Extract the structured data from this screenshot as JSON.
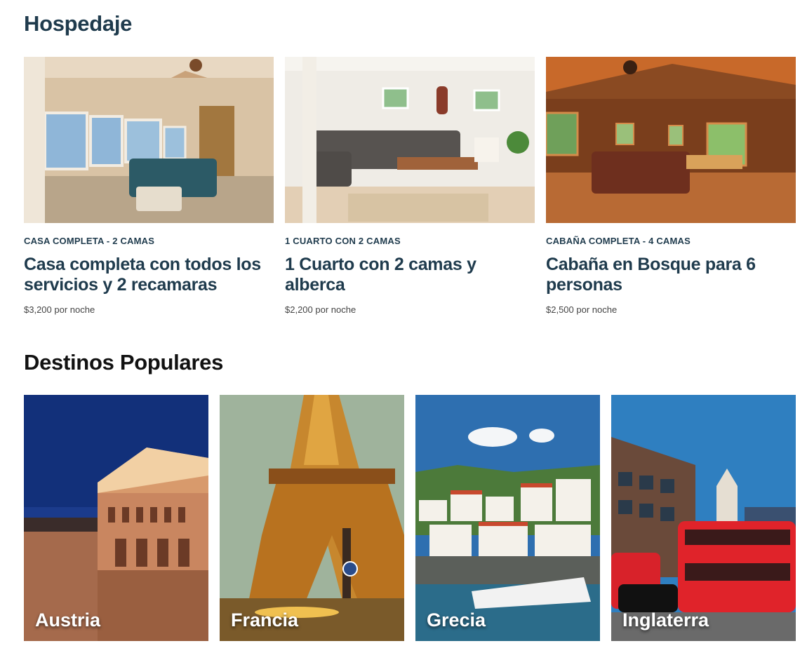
{
  "hospedaje": {
    "title": "Hospedaje",
    "listings": [
      {
        "meta": "CASA COMPLETA - 2 CAMAS",
        "title": "Casa completa con todos los servicios y 2 recamaras",
        "price": "$3,200 por noche"
      },
      {
        "meta": "1 CUARTO CON 2 CAMAS",
        "title": "1 Cuarto con 2 camas y alberca",
        "price": "$2,200 por noche"
      },
      {
        "meta": "CABAÑA COMPLETA - 4 CAMAS",
        "title": "Cabaña en Bosque para 6 personas",
        "price": "$2,500 por noche"
      }
    ]
  },
  "destinos": {
    "title": "Destinos Populares",
    "items": [
      {
        "name": "Austria"
      },
      {
        "name": "Francia"
      },
      {
        "name": "Grecia"
      },
      {
        "name": "Inglaterra"
      }
    ]
  }
}
